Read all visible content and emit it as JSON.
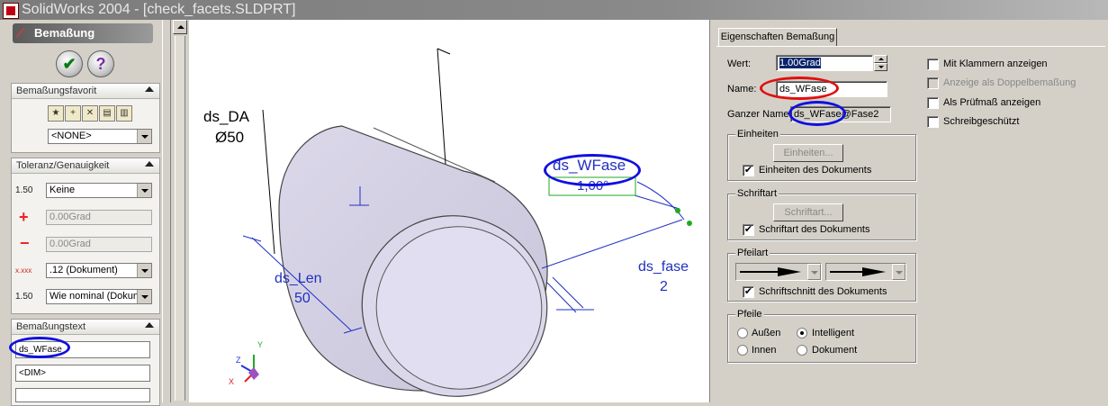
{
  "window": {
    "title": "SolidWorks 2004 - [check_facets.SLDPRT]"
  },
  "property_manager": {
    "header": "Bemaßung",
    "ok_symbol": "✔",
    "help_symbol": "?",
    "favorites": {
      "title": "Bemaßungsfavorit",
      "selected": "<NONE>"
    },
    "tolerance": {
      "title": "Toleranz/Genauigkeit",
      "type_icon": "1.50",
      "type_value": "Keine",
      "plus_value": "0.00Grad",
      "minus_value": "0.00Grad",
      "precision_icon": "x.xxx",
      "precision_value": ".12 (Dokument)",
      "tol_precision_icon": "1.50",
      "tol_precision_value": "Wie nominal (Dokument)"
    },
    "dimtext": {
      "title": "Bemaßungstext",
      "line1": "ds_WFase",
      "line2": "<DIM>"
    }
  },
  "graphics": {
    "dim_da_name": "ds_DA",
    "dim_da_value": "Ø50",
    "dim_len_name": "ds_Len",
    "dim_len_value": "50",
    "dim_wfase_name": "ds_WFase",
    "dim_wfase_value": "1,00°",
    "dim_fase_name": "ds_fase",
    "dim_fase_value": "2",
    "triad_x": "X",
    "triad_y": "Y",
    "triad_z": "Z"
  },
  "dialog": {
    "tab": "Eigenschaften Bemaßung",
    "wert_label": "Wert:",
    "wert_value": "1.00Grad",
    "name_label": "Name:",
    "name_value": "ds_WFase",
    "fullname_label": "Ganzer Name:",
    "fullname_value": "ds_WFase@Fase2",
    "einheiten": {
      "title": "Einheiten",
      "button": "Einheiten...",
      "check_label": "Einheiten des Dokuments",
      "checked": "✔"
    },
    "schriftart": {
      "title": "Schriftart",
      "button": "Schriftart...",
      "check_label": "Schriftart des Dokuments",
      "checked": "✔"
    },
    "pfeilart": {
      "title": "Pfeilart",
      "check_label": "Schriftschnitt des Dokuments",
      "checked": "✔"
    },
    "pfeile": {
      "title": "Pfeile",
      "opt_aussen": "Außen",
      "opt_intelligent": "Intelligent",
      "opt_innen": "Innen",
      "opt_dokument": "Dokument",
      "selected": "Intelligent"
    },
    "options": {
      "klammern": "Mit Klammern anzeigen",
      "doppel": "Anzeige als Doppelbemaßung",
      "pruef": "Als Prüfmaß anzeigen",
      "schreib": "Schreibgeschützt"
    }
  },
  "colors": {
    "highlight_blue": "#1010e0",
    "highlight_red": "#e01010",
    "dimension_blue": "#2030c0",
    "part_face": "#d8d4ec"
  }
}
